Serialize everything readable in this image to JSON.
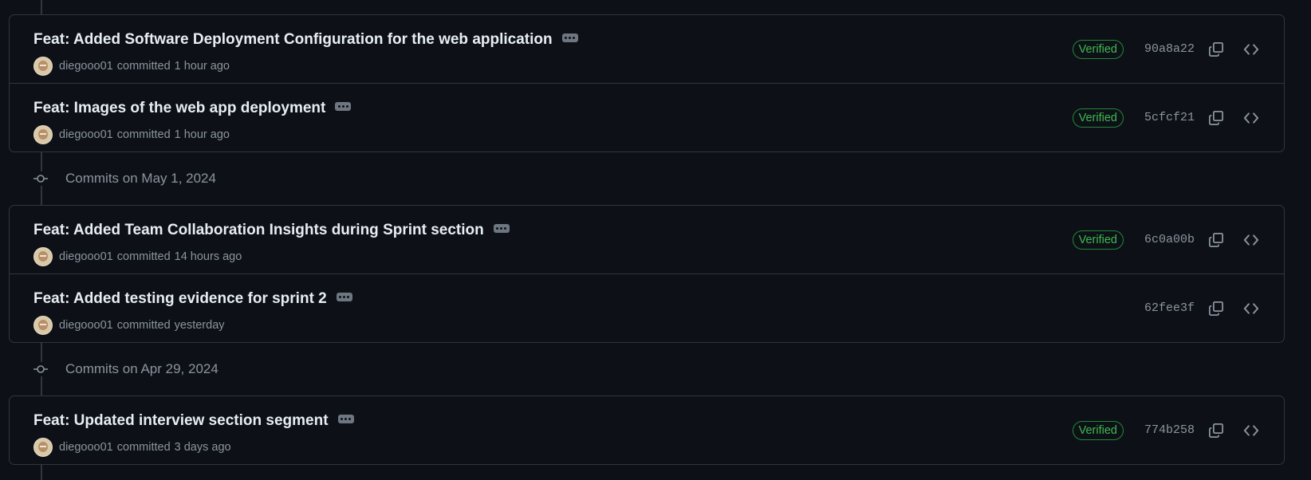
{
  "groups": [
    {
      "title": "",
      "commits": [
        {
          "message": "Feat: Added Software Deployment Configuration for the web application",
          "author": "diegooo01",
          "verb": "committed",
          "time": "1 hour ago",
          "verified": "Verified",
          "sha": "90a8a22"
        },
        {
          "message": "Feat: Images of the web app deployment",
          "author": "diegooo01",
          "verb": "committed",
          "time": "1 hour ago",
          "verified": "Verified",
          "sha": "5cfcf21"
        }
      ]
    },
    {
      "title": "Commits on May 1, 2024",
      "commits": [
        {
          "message": "Feat: Added Team Collaboration Insights during Sprint section",
          "author": "diegooo01",
          "verb": "committed",
          "time": "14 hours ago",
          "verified": "Verified",
          "sha": "6c0a00b"
        },
        {
          "message": "Feat: Added testing evidence for sprint 2",
          "author": "diegooo01",
          "verb": "committed",
          "time": "yesterday",
          "verified": "",
          "sha": "62fee3f"
        }
      ]
    },
    {
      "title": "Commits on Apr 29, 2024",
      "commits": [
        {
          "message": "Feat: Updated interview section segment",
          "author": "diegooo01",
          "verb": "committed",
          "time": "3 days ago",
          "verified": "Verified",
          "sha": "774b258"
        }
      ]
    }
  ],
  "icons": {
    "ellipsis": "ellipsis-icon",
    "copy": "copy-icon",
    "browse": "code-icon",
    "timeline": "git-commit-icon"
  },
  "colors": {
    "background": "#0d1117",
    "border": "#30363d",
    "verified": "#3fb950",
    "muted": "#8b949e",
    "text": "#e6edf3"
  }
}
